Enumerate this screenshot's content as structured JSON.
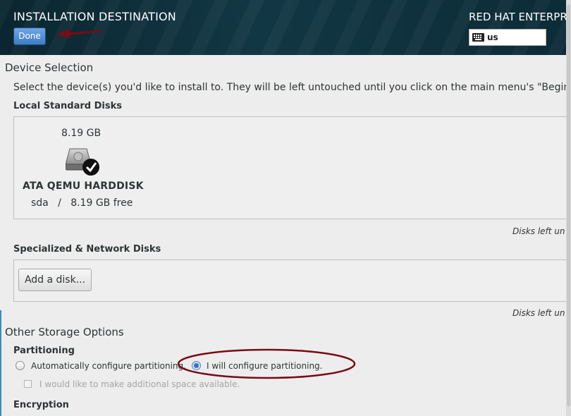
{
  "header": {
    "title": "INSTALLATION DESTINATION",
    "done_label": "Done",
    "product": "RED HAT ENTERPRIS",
    "keyboard_layout": "us"
  },
  "device_selection": {
    "heading": "Device Selection",
    "description": "Select the device(s) you'd like to install to.  They will be left untouched until you click on the main menu's \"Begin In",
    "local_label": "Local Standard Disks",
    "disk": {
      "size": "8.19 GB",
      "name": "ATA QEMU HARDDISK",
      "device": "sda",
      "separator": "/",
      "free": "8.19 GB free",
      "selected": true
    },
    "disks_left_local": "Disks left un",
    "specialized_label": "Specialized & Network Disks",
    "add_disk_label": "Add a disk...",
    "disks_left_network": "Disks left un"
  },
  "other_storage": {
    "heading": "Other Storage Options",
    "partitioning_label": "Partitioning",
    "auto_option": "Automatically configure partitioning.",
    "manual_option": "I will configure partitioning.",
    "selected": "manual",
    "extra_space_option": "I would like to make additional space available.",
    "encryption_label": "Encryption"
  },
  "colors": {
    "annotation": "#7a0a14",
    "done_button": "#4a86d0",
    "header_bg": "#0f2f3a"
  },
  "icons": [
    "keyboard-icon",
    "harddisk-icon",
    "checkmark-icon"
  ]
}
